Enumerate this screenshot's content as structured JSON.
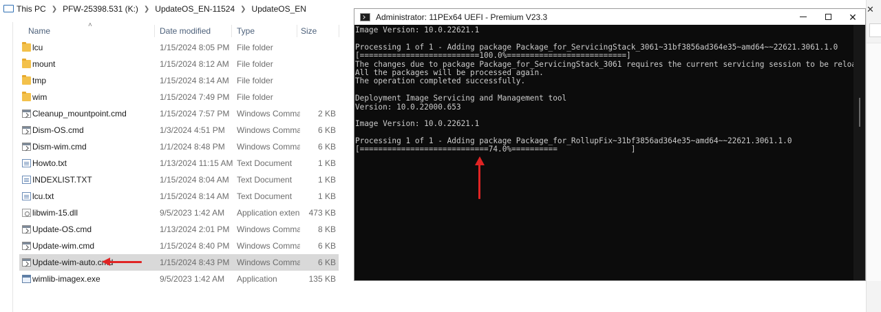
{
  "explorer": {
    "breadcrumb": [
      "This PC",
      "PFW-25398.531 (K:)",
      "UpdateOS_EN-11524",
      "UpdateOS_EN"
    ],
    "columns": {
      "name": "Name",
      "date": "Date modified",
      "type": "Type",
      "size": "Size"
    },
    "files": [
      {
        "name": "lcu",
        "date": "1/15/2024 8:05 PM",
        "type": "File folder",
        "size": "",
        "icon": "folder-icon"
      },
      {
        "name": "mount",
        "date": "1/15/2024 8:12 AM",
        "type": "File folder",
        "size": "",
        "icon": "folder-icon"
      },
      {
        "name": "tmp",
        "date": "1/15/2024 8:14 AM",
        "type": "File folder",
        "size": "",
        "icon": "folder-icon"
      },
      {
        "name": "wim",
        "date": "1/15/2024 7:49 PM",
        "type": "File folder",
        "size": "",
        "icon": "folder-icon"
      },
      {
        "name": "Cleanup_mountpoint.cmd",
        "date": "1/15/2024 7:57 PM",
        "type": "Windows Comma...",
        "size": "2 KB",
        "icon": "cmd-file-icon"
      },
      {
        "name": "Dism-OS.cmd",
        "date": "1/3/2024 4:51 PM",
        "type": "Windows Comma...",
        "size": "6 KB",
        "icon": "cmd-file-icon"
      },
      {
        "name": "Dism-wim.cmd",
        "date": "1/1/2024 8:48 PM",
        "type": "Windows Comma...",
        "size": "6 KB",
        "icon": "cmd-file-icon"
      },
      {
        "name": "Howto.txt",
        "date": "1/13/2024 11:15 AM",
        "type": "Text Document",
        "size": "1 KB",
        "icon": "text-file-icon"
      },
      {
        "name": "INDEXLIST.TXT",
        "date": "1/15/2024 8:04 AM",
        "type": "Text Document",
        "size": "1 KB",
        "icon": "text-file-icon"
      },
      {
        "name": "lcu.txt",
        "date": "1/15/2024 8:14 AM",
        "type": "Text Document",
        "size": "1 KB",
        "icon": "text-file-icon"
      },
      {
        "name": "libwim-15.dll",
        "date": "9/5/2023 1:42 AM",
        "type": "Application exten...",
        "size": "473 KB",
        "icon": "dll-file-icon"
      },
      {
        "name": "Update-OS.cmd",
        "date": "1/13/2024 2:01 PM",
        "type": "Windows Comma...",
        "size": "8 KB",
        "icon": "cmd-file-icon"
      },
      {
        "name": "Update-wim.cmd",
        "date": "1/15/2024 8:40 PM",
        "type": "Windows Comma...",
        "size": "6 KB",
        "icon": "cmd-file-icon"
      },
      {
        "name": "Update-wim-auto.cmd",
        "date": "1/15/2024 8:43 PM",
        "type": "Windows Comma...",
        "size": "6 KB",
        "icon": "cmd-file-icon",
        "selected": true
      },
      {
        "name": "wimlib-imagex.exe",
        "date": "9/5/2023 1:42 AM",
        "type": "Application",
        "size": "135 KB",
        "icon": "exe-file-icon"
      }
    ]
  },
  "console": {
    "title": "Administrator:  11PEx64 UEFI - Premium V23.3",
    "lines": [
      "Image Version: 10.0.22621.1",
      "",
      "Processing 1 of 1 - Adding package Package_for_ServicingStack_3061~31bf3856ad364e35~amd64~~22621.3061.1.0",
      "[==========================100.0%==========================]",
      "The changes due to package Package_for_ServicingStack_3061 requires the current servicing session to be reloaded.",
      "All the packages will be processed again.",
      "The operation completed successfully.",
      "",
      "Deployment Image Servicing and Management tool",
      "Version: 10.0.22000.653",
      "",
      "Image Version: 10.0.22621.1",
      "",
      "Processing 1 of 1 - Adding package Package_for_RollupFix~31bf3856ad364e35~amd64~~22621.3061.1.0",
      "[============================74.0%==========                ]"
    ],
    "progress_percent": 74.0
  },
  "colors": {
    "annotation_arrow": "#e02424",
    "console_bg": "#0c0c0c",
    "console_text": "#cccccc",
    "selected_row": "#d9d9d9"
  }
}
